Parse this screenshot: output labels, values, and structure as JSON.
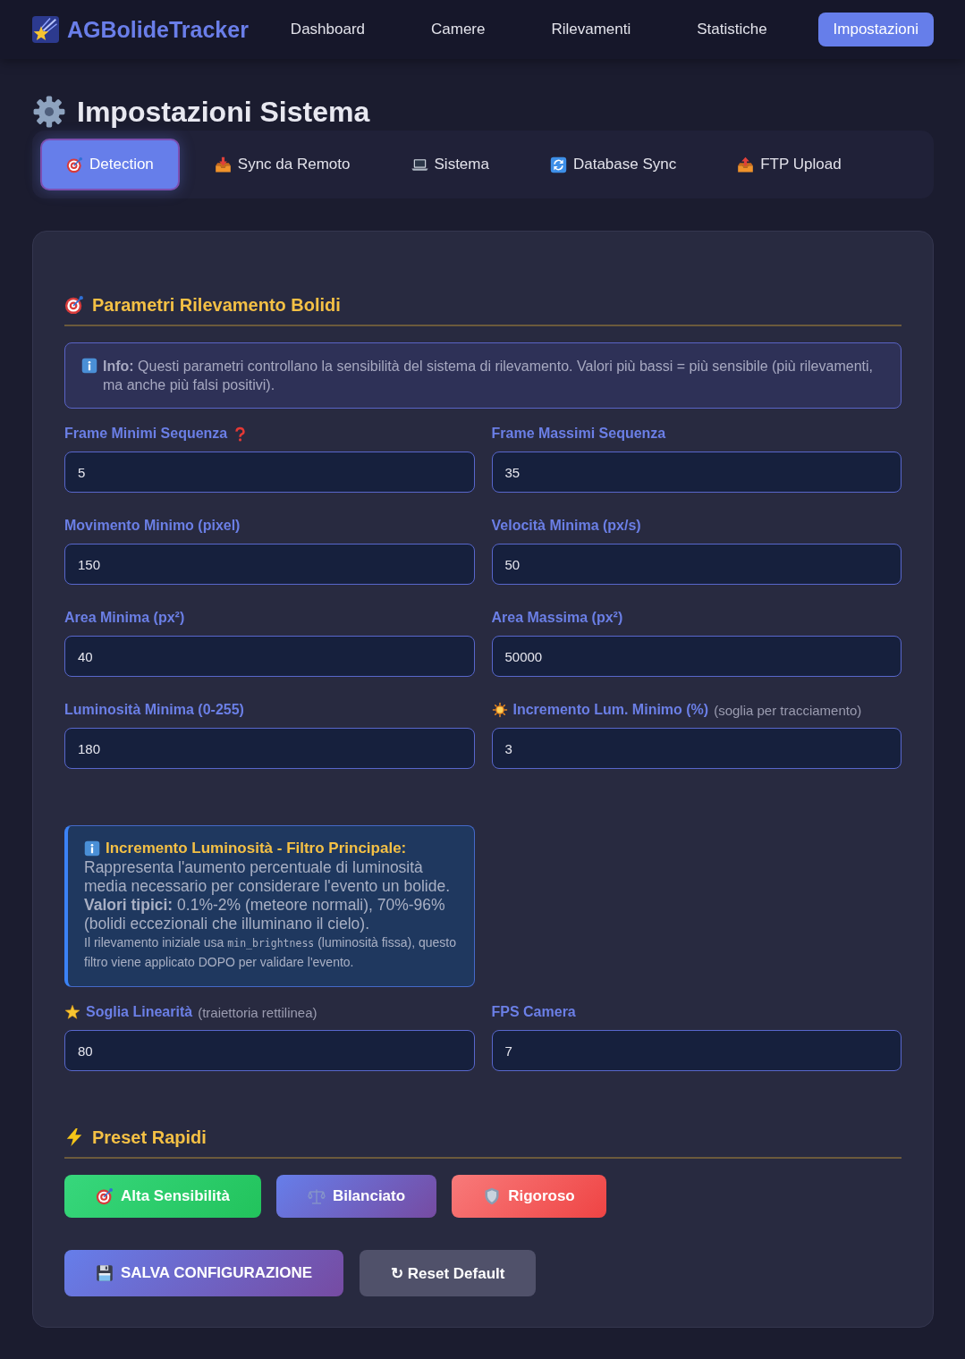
{
  "nav": {
    "brand": "AGBolideTracker",
    "links": [
      {
        "label": "Dashboard",
        "selected": false
      },
      {
        "label": "Camere",
        "selected": false
      },
      {
        "label": "Rilevamenti",
        "selected": false
      },
      {
        "label": "Statistiche",
        "selected": false
      },
      {
        "label": "Impostazioni",
        "selected": true
      }
    ]
  },
  "page_title": "Impostazioni Sistema",
  "tabs": [
    {
      "label": "Detection",
      "selected": true
    },
    {
      "label": "Sync da Remoto",
      "selected": false
    },
    {
      "label": "Sistema",
      "selected": false
    },
    {
      "label": "Database Sync",
      "selected": false
    },
    {
      "label": "FTP Upload",
      "selected": false
    }
  ],
  "detection": {
    "title": "Parametri Rilevamento Bolidi",
    "info": "**Info:** Questi parametri controllano la sensibilità del sistema di rilevamento. Valori più bassi = più sensibile (più rilevamenti, ma anche più falsi positivi).",
    "items": [
      {
        "kind": "field",
        "label": "Frame Minimi Sequenza",
        "value": "5"
      },
      {
        "kind": "field",
        "label": "Frame Massimi Sequenza",
        "value": "35"
      },
      {
        "kind": "field",
        "label": "Movimento Minimo (pixel)",
        "value": "150"
      },
      {
        "kind": "field",
        "label": "Velocità Minima (px/s)",
        "value": "50"
      },
      {
        "kind": "field",
        "label": "Area Minima (px²)",
        "value": "40"
      },
      {
        "kind": "field",
        "label": "Area Massima (px²)",
        "value": "50000"
      },
      {
        "kind": "field",
        "label": "Luminosità Minima (0-255)",
        "value": "180"
      },
      {
        "kind": "field",
        "label": "Incremento Lum. Minimo (%)",
        "label_note": "(soglia per tracciamento)",
        "value": "3"
      },
      {
        "kind": "note",
        "title": "Incremento Luminosità - Filtro Principale:",
        "paragraphs": [
          "Rappresenta l'aumento percentuale di luminosità media necessario per considerare l'evento un bolide.",
          "**Valori tipici:** 0.1%-2% (meteore normali), 70%-96% (bolidi eccezionali che illuminano il cielo)."
        ],
        "footnote": {
          "before": "Il rilevamento iniziale usa",
          "code": "min_brightness",
          "after": "(luminosità fissa), questo filtro viene applicato DOPO per validare l'evento."
        }
      },
      {
        "kind": "field",
        "label": "Soglia Linearità",
        "label_note": "(traiettoria rettilinea)",
        "value": "80"
      },
      {
        "kind": "field",
        "label": "FPS Camera",
        "value": "7"
      }
    ]
  },
  "presets": {
    "title": "Preset Rapidi",
    "buttons": [
      {
        "kind": "sensitive",
        "label": "Alta Sensibilità"
      },
      {
        "kind": "balanced",
        "label": "Bilanciato"
      },
      {
        "kind": "strict",
        "label": "Rigoroso"
      }
    ]
  },
  "actions": [
    {
      "kind": "save",
      "label": "SALVA CONFIGURAZIONE"
    },
    {
      "kind": "reset",
      "label": "↻ Reset Default"
    }
  ]
}
